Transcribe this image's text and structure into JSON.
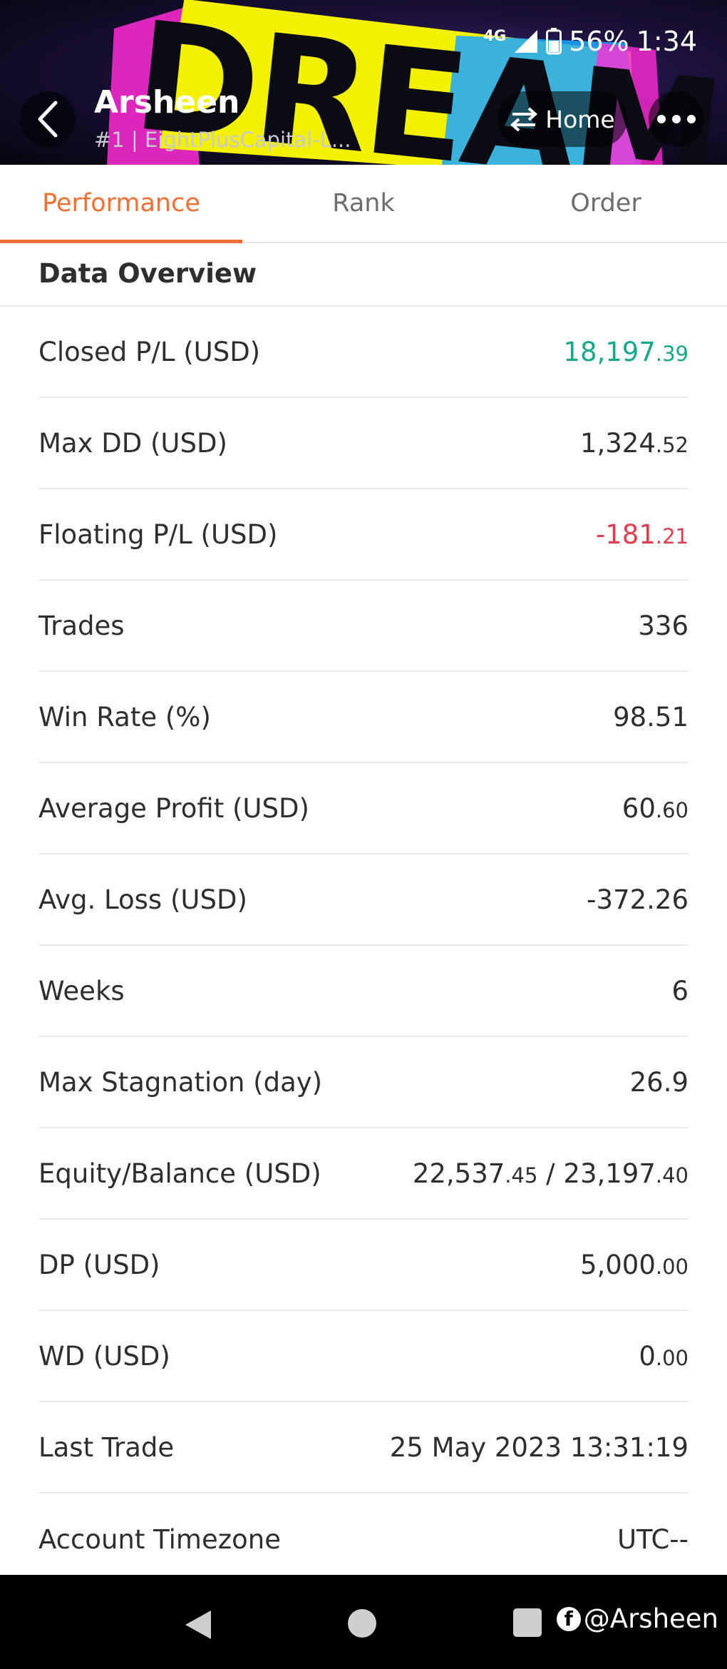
{
  "status_bar": {
    "network": "4G",
    "battery": "56%",
    "time": "1:34"
  },
  "header": {
    "banner_text": "DREAM",
    "account_name": "Arsheen",
    "account_subtitle": "#1 | EightPlusCapital-L...",
    "home_label": "Home"
  },
  "tabs": [
    {
      "label": "Performance",
      "active": true
    },
    {
      "label": "Rank",
      "active": false
    },
    {
      "label": "Order",
      "active": false
    }
  ],
  "section_title": "Data Overview",
  "rows": [
    {
      "label": "Closed P/L (USD)",
      "int": "18,197",
      "dec": ".39",
      "color": "#17a88c"
    },
    {
      "label": "Max DD (USD)",
      "int": "1,324",
      "dec": ".52"
    },
    {
      "label": "Floating P/L (USD)",
      "int": "-181",
      "dec": ".21",
      "color": "#e23d4f"
    },
    {
      "label": "Trades",
      "int": "336",
      "dec": ""
    },
    {
      "label": "Win Rate (%)",
      "int": "98.51",
      "dec": ""
    },
    {
      "label": "Average Profit (USD)",
      "int": "60",
      "dec": ".60"
    },
    {
      "label": "Avg. Loss (USD)",
      "int": "-372.26",
      "dec": ""
    },
    {
      "label": "Weeks",
      "int": "6",
      "dec": ""
    },
    {
      "label": "Max Stagnation (day)",
      "int": "26.9",
      "dec": ""
    },
    {
      "label": "Equity/Balance (USD)",
      "int": "22,537",
      "dec": ".45",
      "sep": " / ",
      "int2": "23,197",
      "dec2": ".40"
    },
    {
      "label": "DP (USD)",
      "int": "5,000",
      "dec": ".00"
    },
    {
      "label": "WD (USD)",
      "int": "0",
      "dec": ".00"
    },
    {
      "label": "Last Trade",
      "int": "25 May 2023 13:31:19",
      "dec": ""
    },
    {
      "label": "Account Timezone",
      "int": "UTC--",
      "dec": ""
    }
  ],
  "nav": {
    "watermark": "@Arsheen"
  },
  "colors": {
    "accent": "#f07034",
    "positive": "#17a88c",
    "negative": "#e23d4f"
  }
}
